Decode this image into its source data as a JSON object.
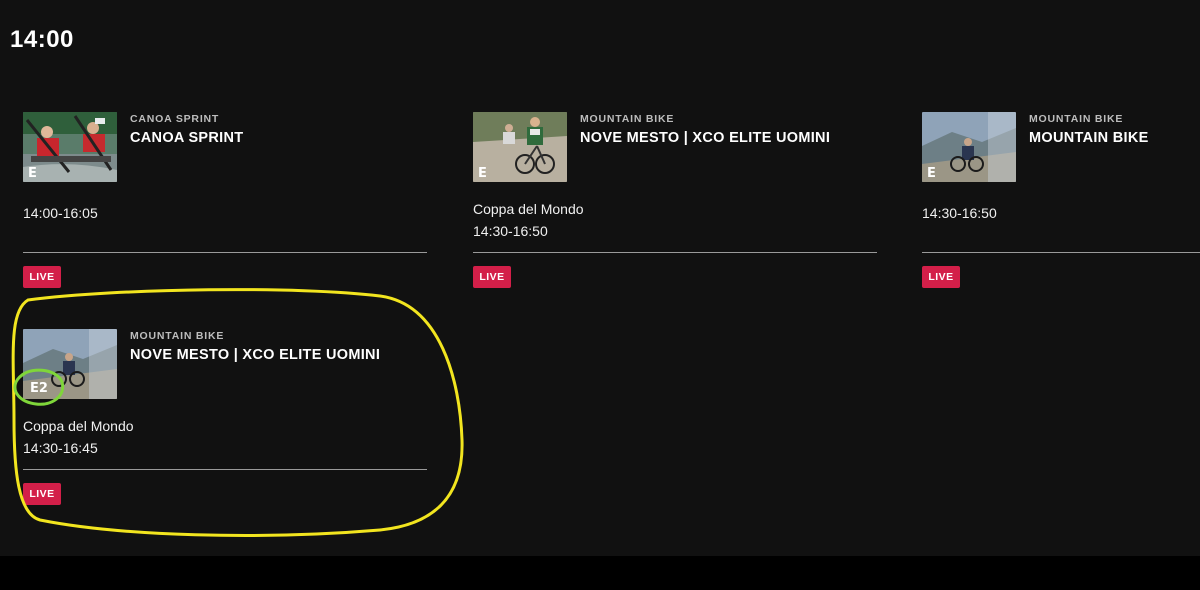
{
  "schedule": {
    "time_heading": "14:00",
    "cards": [
      {
        "category": "CANOA SPRINT",
        "title": "CANOA SPRINT",
        "subtitle": "",
        "times": "14:00-16:05",
        "badge": "LIVE",
        "channel_mark": "E",
        "thumbnail_icon": "canoe-sprint-thumbnail"
      },
      {
        "category": "MOUNTAIN BIKE",
        "title": "NOVE MESTO | XCO ELITE UOMINI",
        "subtitle": "Coppa del Mondo",
        "times": "14:30-16:50",
        "badge": "LIVE",
        "channel_mark": "E",
        "thumbnail_icon": "mountain-bike-race-thumbnail"
      },
      {
        "category": "MOUNTAIN BIKE",
        "title": "MOUNTAIN BIKE",
        "subtitle": "",
        "times": "14:30-16:50",
        "badge": "LIVE",
        "channel_mark": "E",
        "thumbnail_icon": "mountain-bike-trail-thumbnail"
      },
      {
        "category": "MOUNTAIN BIKE",
        "title": "NOVE MESTO | XCO ELITE UOMINI",
        "subtitle": "Coppa del Mondo",
        "times": "14:30-16:45",
        "badge": "LIVE",
        "channel_mark": "E2",
        "thumbnail_icon": "mountain-bike-trail-thumbnail"
      }
    ]
  },
  "colors": {
    "background": "#111111",
    "live_badge": "#d31f49",
    "annotation_yellow": "#f2e51f",
    "annotation_green": "#7fd63a"
  }
}
